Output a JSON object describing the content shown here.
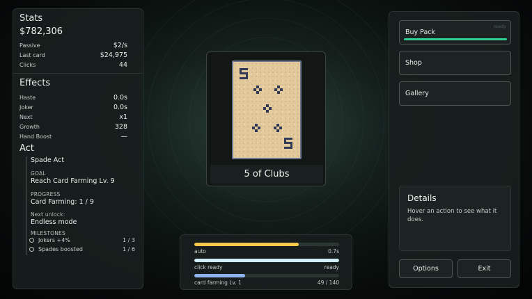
{
  "colors": {
    "auto_bar": "#f2c94c",
    "click_bar": "#cfeefa",
    "farming_bar": "#8fb3f0",
    "buy_bar": "#2fcf94",
    "card_ink": "#333a58"
  },
  "stats": {
    "title": "Stats",
    "money": "$782,306",
    "rows": [
      {
        "label": "Passive",
        "value": "$2/s"
      },
      {
        "label": "Last card",
        "value": "$24,975"
      },
      {
        "label": "Clicks",
        "value": "44"
      }
    ]
  },
  "effects": {
    "title": "Effects",
    "rows": [
      {
        "label": "Haste",
        "value": "0.0s"
      },
      {
        "label": "Joker",
        "value": "0.0s"
      },
      {
        "label": "Next",
        "value": "x1"
      },
      {
        "label": "Growth",
        "value": "328"
      },
      {
        "label": "Hand Boost",
        "value": "—"
      }
    ]
  },
  "act": {
    "title": "Act",
    "name": "Spade Act",
    "goal_label": "GOAL",
    "goal": "Reach Card Farming Lv. 9",
    "progress_label": "PROGRESS",
    "progress": "Card Farming: 1 / 9",
    "next_unlock_label": "Next unlock:",
    "next_unlock": "Endless mode",
    "milestones_label": "MILESTONES",
    "milestones": [
      {
        "name": "Jokers +4%",
        "count": "1 / 3"
      },
      {
        "name": "Spades boosted",
        "count": "1 / 6"
      }
    ]
  },
  "card": {
    "label": "5 of Clubs",
    "rank": "5",
    "suit": "clubs"
  },
  "progress": {
    "auto": {
      "label": "auto",
      "value": "0.7s",
      "fraction": 0.72
    },
    "click": {
      "label": "click ready",
      "value": "ready",
      "fraction": 1.0
    },
    "farming": {
      "label": "card farming Lv. 1",
      "value": "49 / 140",
      "fraction": 0.35
    }
  },
  "actions": {
    "buy_pack": {
      "label": "Buy Pack",
      "status": "ready",
      "fraction": 1.0
    },
    "shop": {
      "label": "Shop"
    },
    "gallery": {
      "label": "Gallery"
    }
  },
  "details": {
    "title": "Details",
    "text": "Hover an action to see what it does."
  },
  "footer": {
    "options": "Options",
    "exit": "Exit"
  }
}
